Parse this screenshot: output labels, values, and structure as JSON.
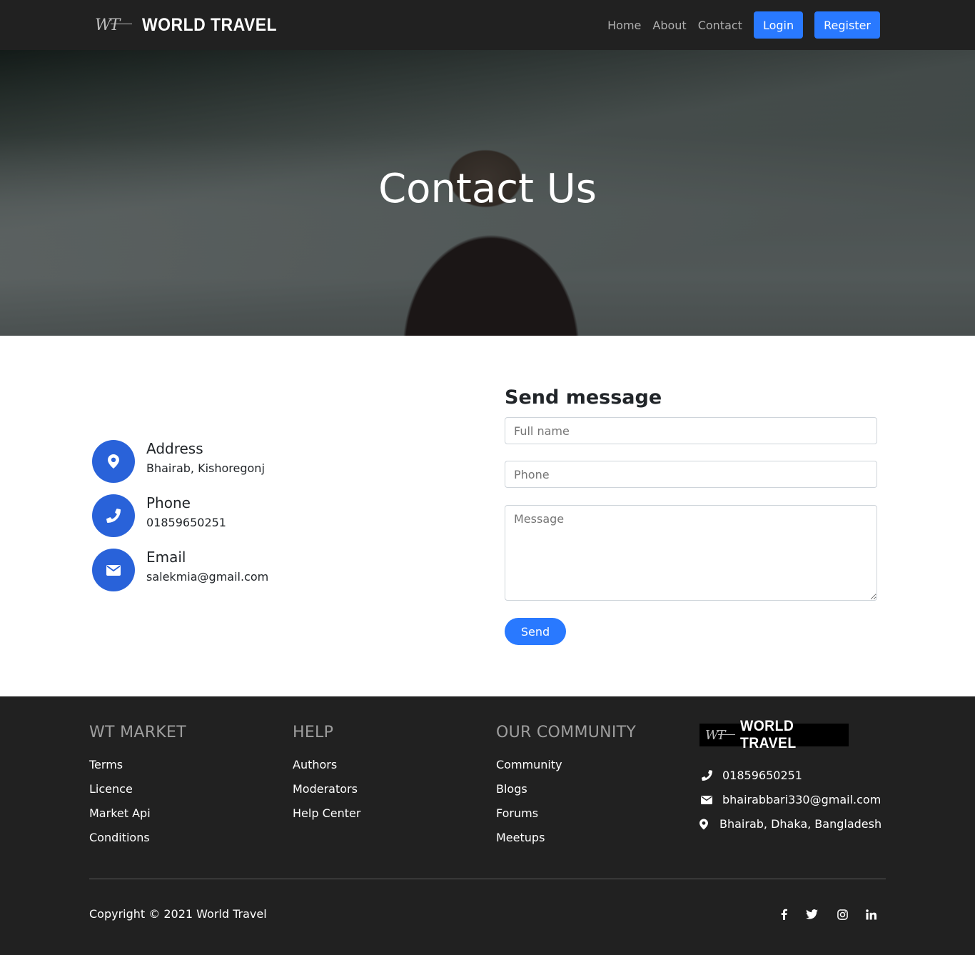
{
  "brand": {
    "mark": "WT",
    "name": "WORLD TRAVEL"
  },
  "nav": {
    "links": [
      "Home",
      "About",
      "Contact"
    ],
    "login_label": "Login",
    "register_label": "Register"
  },
  "hero": {
    "title": "Contact Us"
  },
  "contact_info": [
    {
      "label": "Address",
      "value": "Bhairab, Kishoregonj",
      "icon": "map-marker-icon"
    },
    {
      "label": "Phone",
      "value": "01859650251",
      "icon": "phone-icon"
    },
    {
      "label": "Email",
      "value": "salekmia@gmail.com",
      "icon": "envelope-icon"
    }
  ],
  "form": {
    "title": "Send message",
    "name_placeholder": "Full name",
    "phone_placeholder": "Phone",
    "message_placeholder": "Message",
    "send_label": "Send"
  },
  "footer": {
    "columns": [
      {
        "heading": "WT MARKET",
        "links": [
          "Terms",
          "Licence",
          "Market Api",
          "Conditions"
        ]
      },
      {
        "heading": "HELP",
        "links": [
          "Authors",
          "Moderators",
          "Help Center"
        ]
      },
      {
        "heading": "OUR COMMUNITY",
        "links": [
          "Community",
          "Blogs",
          "Forums",
          "Meetups"
        ]
      }
    ],
    "contact": {
      "phone": "01859650251",
      "email": "bhairabbari330@gmail.com",
      "address": "Bhairab, Dhaka, Bangladesh"
    },
    "copyright": "Copyright © 2021 World Travel",
    "social_icons": [
      "facebook-icon",
      "twitter-icon",
      "instagram-icon",
      "linkedin-icon"
    ]
  },
  "colors": {
    "navbar_bg": "#212121",
    "accent_blue": "#2979ff",
    "icon_circle": "#2962d9",
    "footer_bg": "#212121"
  }
}
